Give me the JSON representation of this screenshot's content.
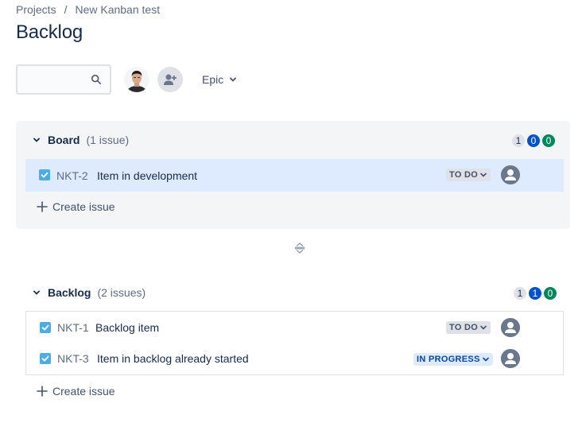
{
  "breadcrumb": {
    "items": [
      "Projects",
      "New Kanban test"
    ],
    "separator": "/"
  },
  "page": {
    "title": "Backlog"
  },
  "toolbar": {
    "search_placeholder": "",
    "epic_label": "Epic"
  },
  "colors": {
    "todo_pill": "#dfe1e6",
    "progress_pill": "#0052cc",
    "done_pill": "#00875a",
    "selected_row": "#deebff",
    "checkbox": "#4bade8"
  },
  "board": {
    "name": "Board",
    "count_label": "(1 issue)",
    "counts": {
      "todo": "1",
      "in_progress": "0",
      "done": "0"
    },
    "issues": [
      {
        "key": "NKT-2",
        "summary": "Item in development",
        "status": "TO DO",
        "icon": "task-checkbox-icon"
      }
    ],
    "create_label": "Create issue"
  },
  "backlog": {
    "name": "Backlog",
    "count_label": "(2 issues)",
    "counts": {
      "todo": "1",
      "in_progress": "1",
      "done": "0"
    },
    "issues": [
      {
        "key": "NKT-1",
        "summary": "Backlog item",
        "status": "TO DO",
        "icon": "task-checkbox-icon"
      },
      {
        "key": "NKT-3",
        "summary": "Item in backlog already started",
        "status": "IN PROGRESS",
        "icon": "task-checkbox-icon"
      }
    ],
    "create_label": "Create issue"
  }
}
